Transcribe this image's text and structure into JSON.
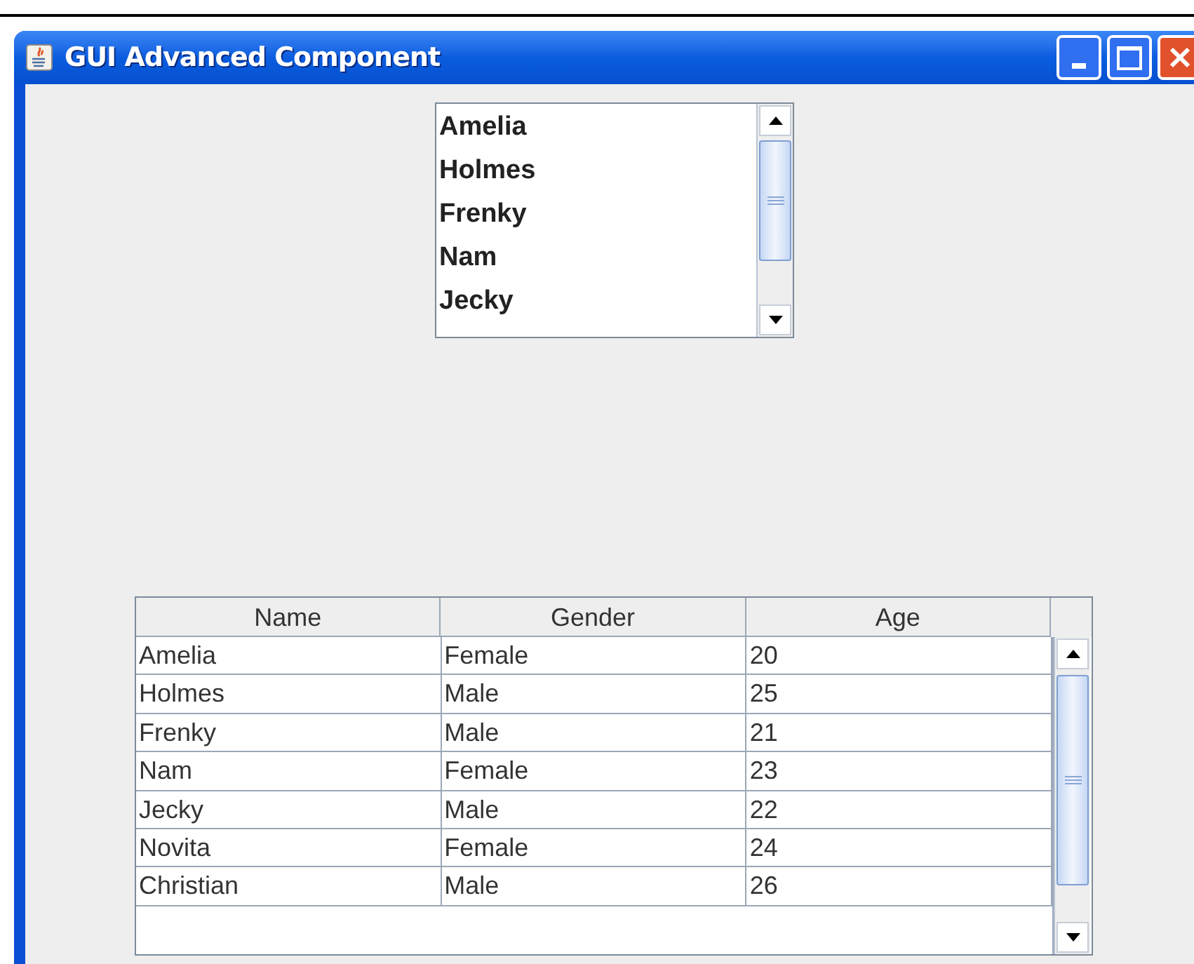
{
  "window": {
    "title": "GUI Advanced Component"
  },
  "list": {
    "items": [
      {
        "label": "Amelia"
      },
      {
        "label": "Holmes"
      },
      {
        "label": "Frenky"
      },
      {
        "label": "Nam"
      },
      {
        "label": "Jecky"
      }
    ]
  },
  "table": {
    "columns": [
      "Name",
      "Gender",
      "Age"
    ],
    "rows": [
      [
        "Amelia",
        "Female",
        "20"
      ],
      [
        "Holmes",
        "Male",
        "25"
      ],
      [
        "Frenky",
        "Male",
        "21"
      ],
      [
        "Nam",
        "Female",
        "23"
      ],
      [
        "Jecky",
        "Male",
        "22"
      ],
      [
        "Novita",
        "Female",
        "24"
      ],
      [
        "Christian",
        "Male",
        "26"
      ]
    ]
  }
}
